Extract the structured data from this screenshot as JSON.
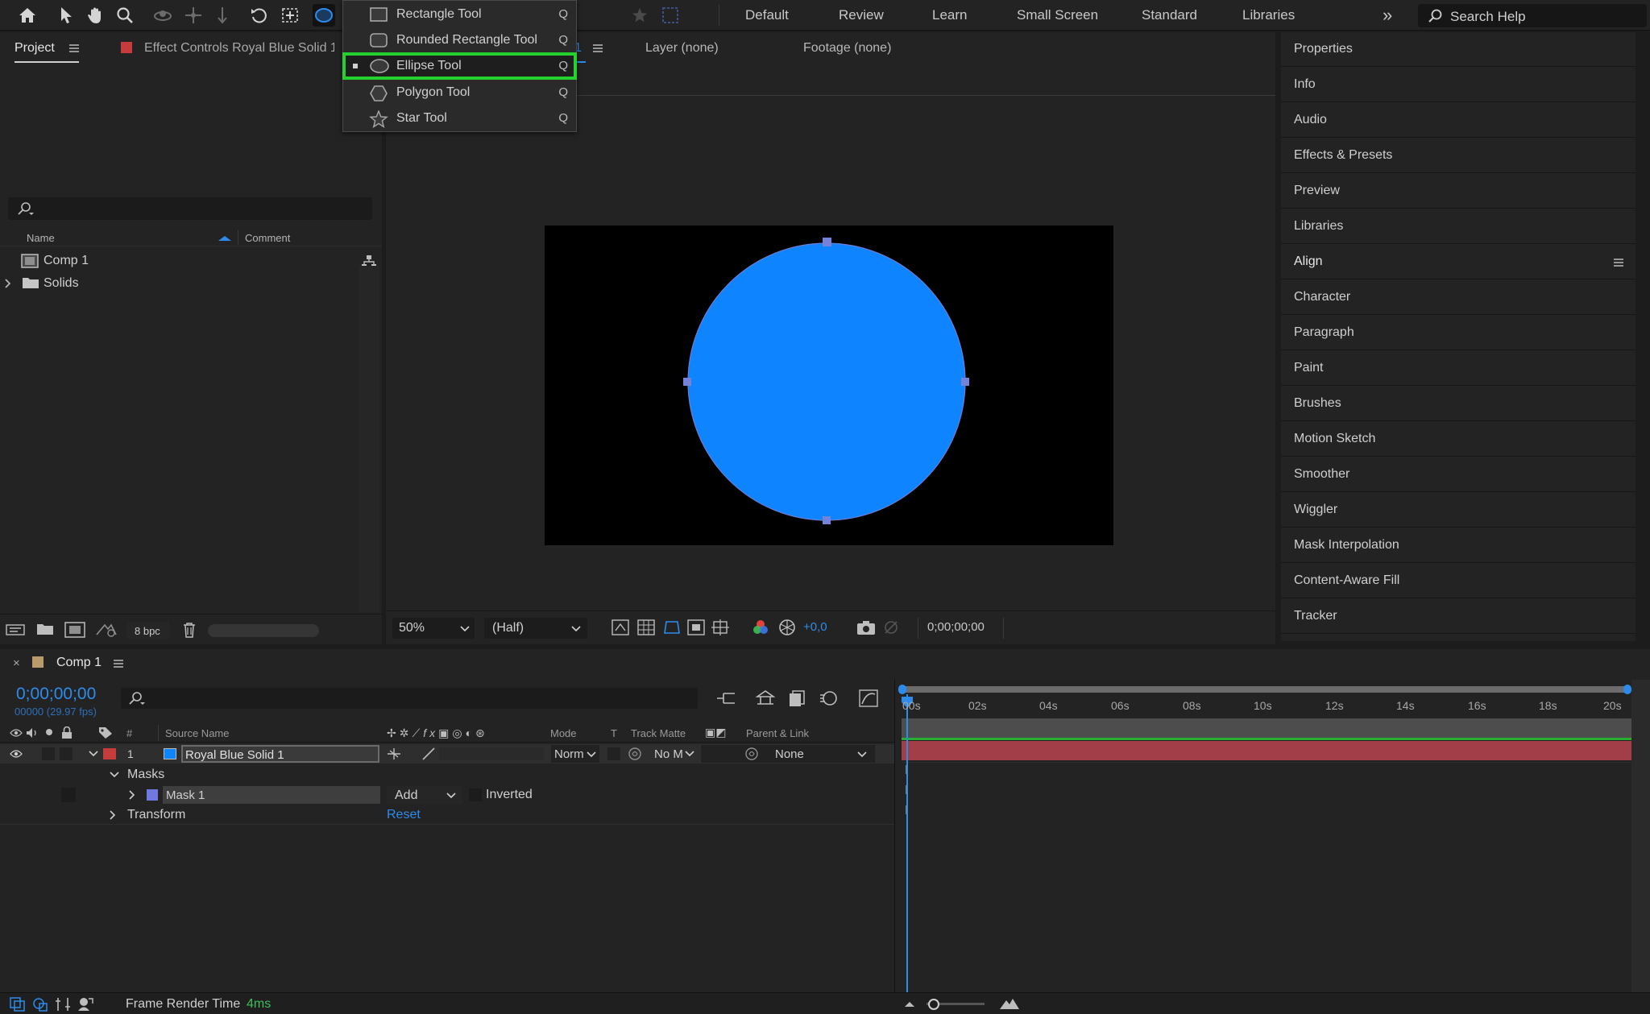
{
  "toolbar": {
    "workspaces": [
      "Default",
      "Review",
      "Learn",
      "Small Screen",
      "Standard",
      "Libraries"
    ],
    "more": "»",
    "search_placeholder": "Search Help"
  },
  "menu": {
    "items": [
      {
        "label": "Rectangle Tool",
        "shortcut": "Q"
      },
      {
        "label": "Rounded Rectangle Tool",
        "shortcut": "Q"
      },
      {
        "label": "Ellipse Tool",
        "shortcut": "Q"
      },
      {
        "label": "Polygon Tool",
        "shortcut": "Q"
      },
      {
        "label": "Star Tool",
        "shortcut": "Q"
      }
    ],
    "selected_index": 2
  },
  "project": {
    "tab": "Project",
    "effect_controls_tab": "Effect Controls Royal Blue Solid 1",
    "columns": {
      "name": "Name",
      "comment": "Comment"
    },
    "items": [
      {
        "label": "Comp 1"
      },
      {
        "label": "Solids"
      }
    ],
    "bpc": "8 bpc"
  },
  "viewer": {
    "comp_tab_suffix": "1",
    "layer_tab": "Layer (none)",
    "footage_tab": "Footage (none)",
    "zoom": "50%",
    "resolution": "(Half)",
    "exposure": "+0,0",
    "timecode": "0;00;00;00"
  },
  "right_panel": {
    "items": [
      "Properties",
      "Info",
      "Audio",
      "Effects & Presets",
      "Preview",
      "Libraries",
      "Align",
      "Character",
      "Paragraph",
      "Paint",
      "Brushes",
      "Motion Sketch",
      "Smoother",
      "Wiggler",
      "Mask Interpolation",
      "Content-Aware Fill",
      "Tracker"
    ]
  },
  "timeline": {
    "tab": "Comp 1",
    "timecode": "0;00;00;00",
    "frame_info": "00000 (29.97 fps)",
    "columns": {
      "num": "#",
      "source": "Source Name",
      "mode": "Mode",
      "t": "T",
      "track": "Track Matte",
      "parent": "Parent & Link"
    },
    "layer": {
      "num": "1",
      "name": "Royal Blue Solid 1",
      "mode": "Norm",
      "track": "No M",
      "parent": "None"
    },
    "masks_label": "Masks",
    "mask_name": "Mask 1",
    "mask_mode": "Add",
    "inverted": "Inverted",
    "transform": "Transform",
    "reset": "Reset",
    "ruler": [
      "00s",
      "02s",
      "04s",
      "06s",
      "08s",
      "10s",
      "12s",
      "14s",
      "16s",
      "18s",
      "20s"
    ]
  },
  "status": {
    "label": "Frame Render Time",
    "value": "4ms"
  },
  "colors": {
    "accent": "#2d8ceb",
    "solid": "#0f84ff",
    "layer_bar": "#a23e47",
    "highlight": "#25d12f"
  }
}
